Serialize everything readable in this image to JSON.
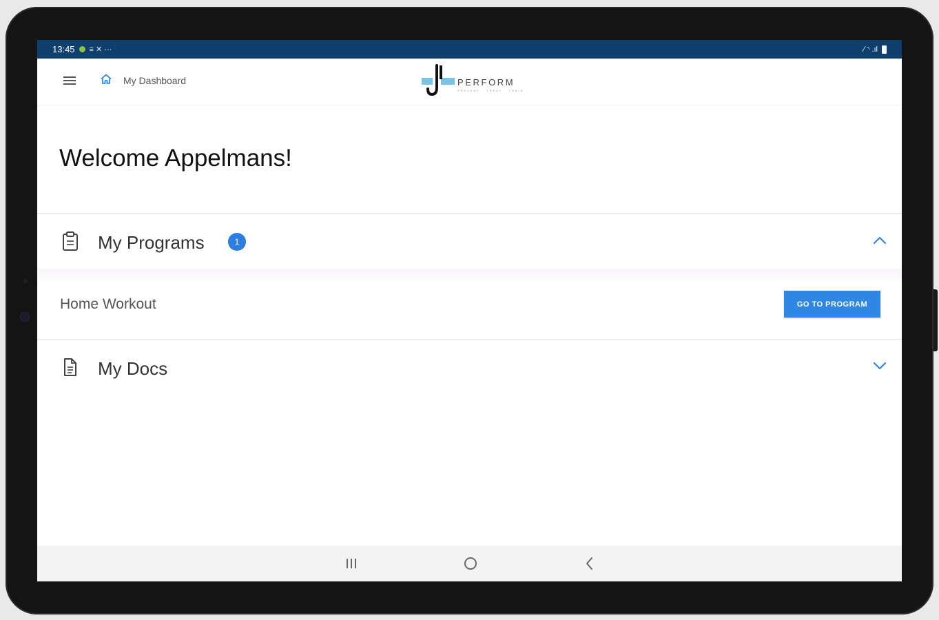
{
  "status_bar": {
    "time": "13:45",
    "left_glyphs": "≡ ✕ ···",
    "right_glyphs": "∕ ◝ .ıl"
  },
  "header": {
    "breadcrumb": "My Dashboard",
    "logo_text": "PERFORM",
    "logo_tagline": "PREVENT · TREAT · TRAIN"
  },
  "welcome_title": "Welcome Appelmans!",
  "sections": {
    "programs": {
      "title": "My Programs",
      "badge_count": "1",
      "expanded": true,
      "items": [
        {
          "name": "Home Workout",
          "button_label": "GO TO PROGRAM"
        }
      ]
    },
    "docs": {
      "title": "My Docs",
      "expanded": false
    }
  },
  "colors": {
    "status_bar": "#0e3f6d",
    "accent_blue": "#2f87e3",
    "badge_blue": "#2c7ee0",
    "logo_accent": "#7ac3e4"
  },
  "icons": {
    "menu": "hamburger-menu-icon",
    "home": "home-icon",
    "programs": "clipboard-icon",
    "docs": "document-icon",
    "collapse": "chevron-up-icon",
    "expand": "chevron-down-icon",
    "nav_recents": "recents-icon",
    "nav_home": "circle-home-icon",
    "nav_back": "back-arrow-icon"
  }
}
